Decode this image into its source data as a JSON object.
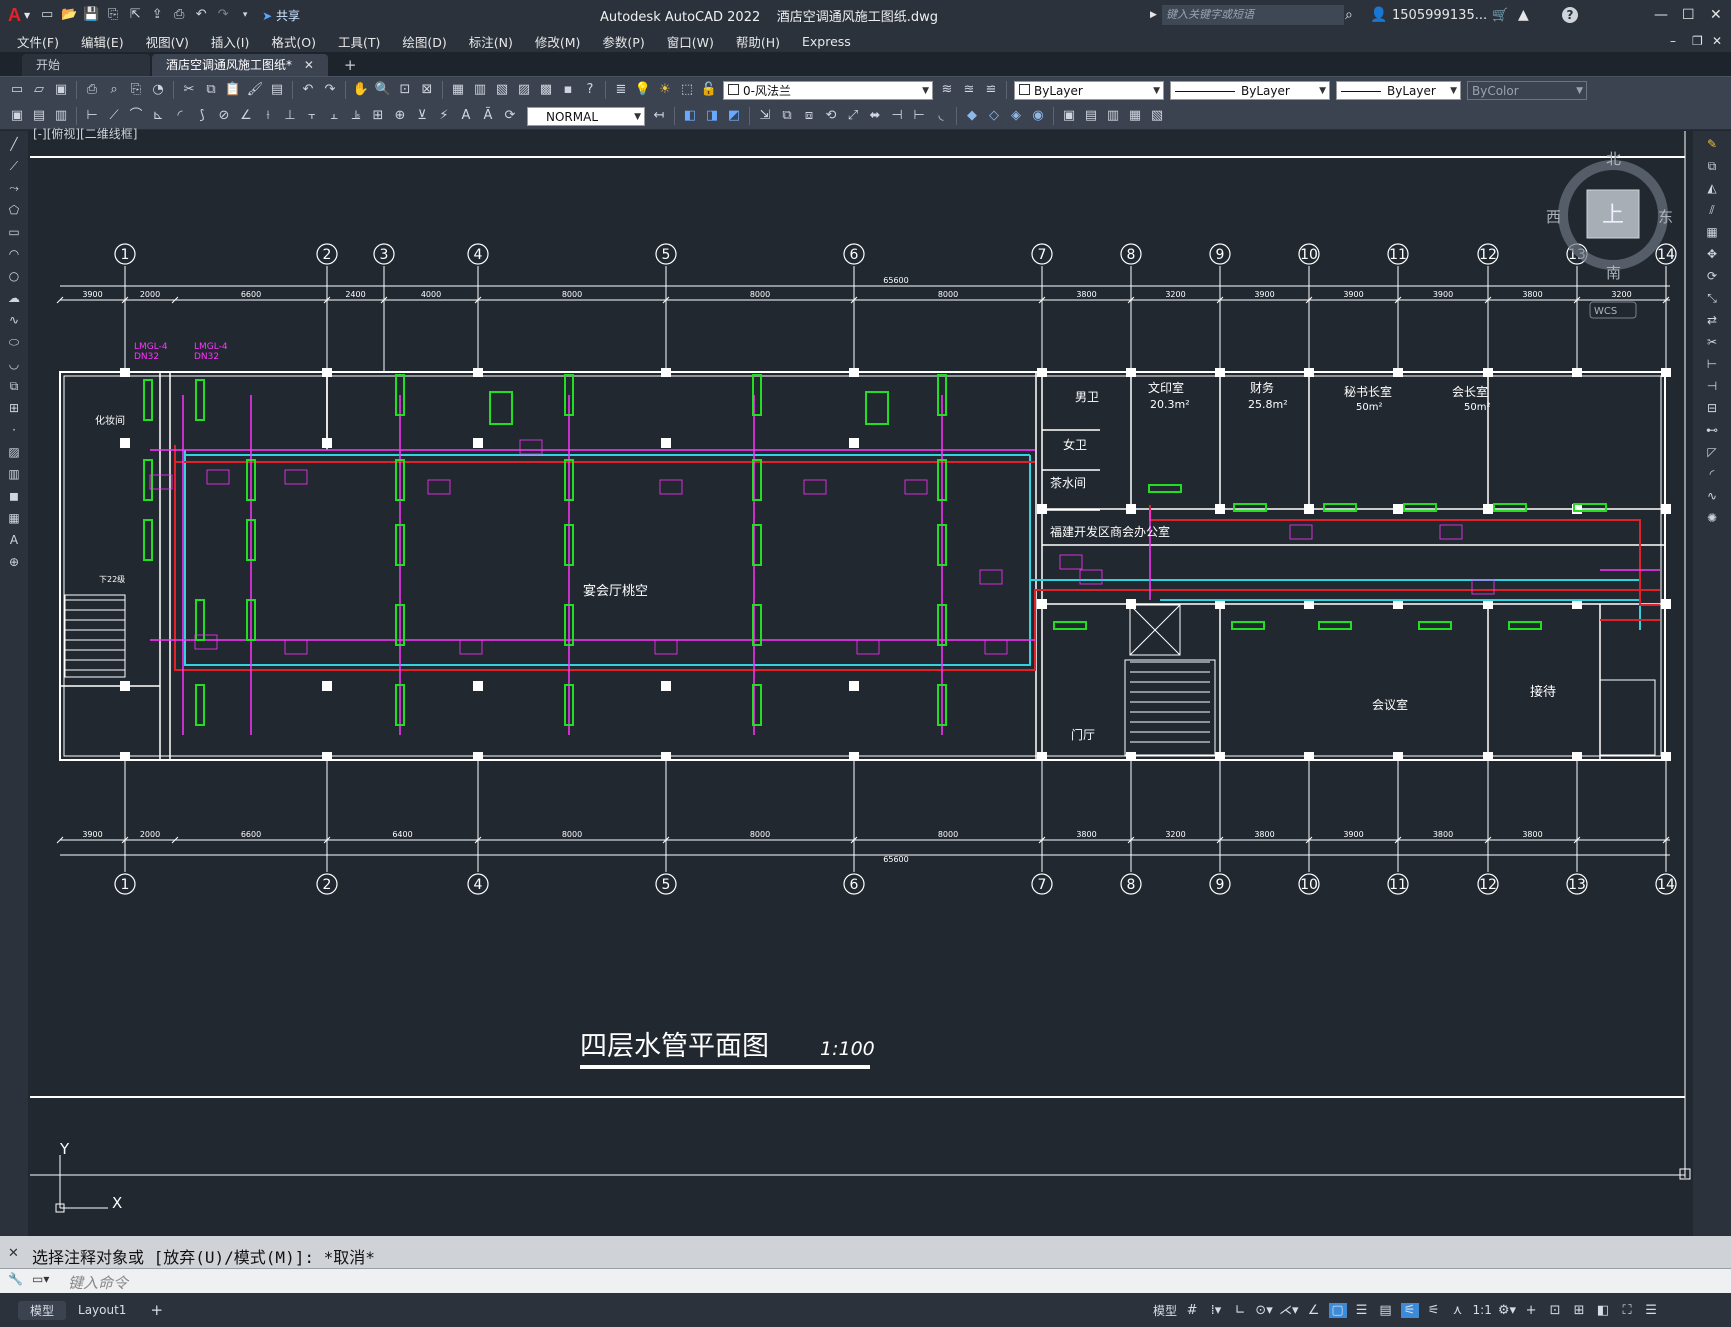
{
  "titlebar": {
    "app_logo": "A",
    "share_label": "共享",
    "title": "Autodesk AutoCAD 2022    酒店空调通风施工图纸.dwg",
    "search_placeholder": "键入关键字或短语",
    "user": "1505999135...",
    "help": "?"
  },
  "menu": [
    "文件(F)",
    "编辑(E)",
    "视图(V)",
    "插入(I)",
    "格式(O)",
    "工具(T)",
    "绘图(D)",
    "标注(N)",
    "修改(M)",
    "参数(P)",
    "窗口(W)",
    "帮助(H)",
    "Express"
  ],
  "tabs": {
    "start": "开始",
    "drawing": "酒店空调通风施工图纸*",
    "add": "+"
  },
  "toolbar1": {
    "layer": "0-风法兰",
    "color": "ByLayer",
    "linetype": "ByLayer",
    "lineweight": "ByLayer",
    "plotstyle": "ByColor"
  },
  "toolbar2": {
    "style": "NORMAL"
  },
  "viewport_label": "[-][俯视][二维线框]",
  "viewcube": {
    "north": "北",
    "south": "南",
    "east": "东",
    "west": "西",
    "face": "上",
    "wcs": "WCS"
  },
  "drawing": {
    "axes": [
      "1",
      "2",
      "3",
      "4",
      "5",
      "6",
      "7",
      "8",
      "9",
      "10",
      "11",
      "12",
      "13",
      "14"
    ],
    "axes_bottom": [
      "1",
      "2",
      "4",
      "5",
      "6",
      "7",
      "8",
      "9",
      "10",
      "11",
      "12",
      "13",
      "14"
    ],
    "dims_top": [
      "3900",
      "2000",
      "6600",
      "2400",
      "4000",
      "8000",
      "8000",
      "8000",
      "3800",
      "3200",
      "3900",
      "3900",
      "3900",
      "3800",
      "3200"
    ],
    "dims_bottom": [
      "3900",
      "2000",
      "6600",
      "6400",
      "8000",
      "8000",
      "8000",
      "3800",
      "3200",
      "3800",
      "3900",
      "3800",
      "3800"
    ],
    "overall": "65600",
    "rooms": [
      "化妆间",
      "宴会厅桃空",
      "男卫",
      "女卫",
      "茶水间",
      "文印室",
      "20.3m²",
      "财务",
      "25.8m²",
      "秘书长室",
      "50m²",
      "会长室",
      "50m²",
      "福建开发区商会办公室",
      "会议室",
      "接待",
      "门厅",
      "下22级"
    ],
    "leaders": [
      "LMGL-4",
      "DN32",
      "LMGL-4",
      "DN32"
    ],
    "title": "四层水管平面图",
    "scale": "1:100",
    "ucs_x": "X",
    "ucs_y": "Y"
  },
  "command": {
    "history": "选择注释对象或 [放弃(U)/模式(M)]: *取消*",
    "placeholder": "键入命令"
  },
  "status": {
    "model": "模型",
    "layout": "Layout1",
    "add": "+",
    "model_btn": "模型",
    "scale": "1:1"
  },
  "colors": {
    "accent_blue": "#3b8bd8",
    "canvas": "#212830",
    "cyan": "#2fd4e0",
    "red": "#e0202a",
    "magenta": "#ff33ff",
    "green": "#22dd22",
    "white": "#ffffff"
  }
}
